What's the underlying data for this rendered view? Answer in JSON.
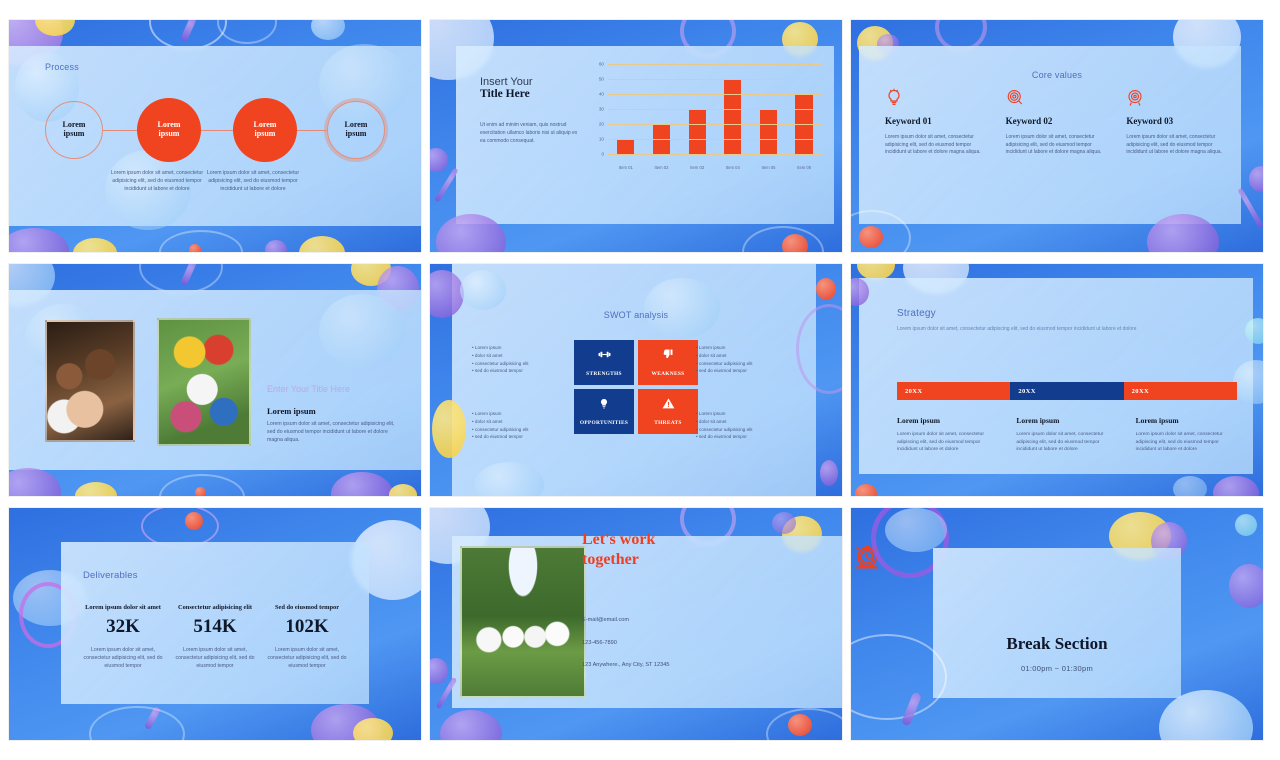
{
  "theme": {
    "accent_red": "#f0431f",
    "accent_blue": "#123d8f",
    "bg_blue": "#3f86ec",
    "panel_blue": "#bfdcfb",
    "title_color": "#4f6fbf"
  },
  "common": {
    "lorem_short": "Lorem ipsum dolor sit amet, consectetur adipisicing elit, sed do eiusmod tempor incididunt ut labore et dolore",
    "lorem_magna": "Lorem ipsum dolor sit amet, consectetur adipisicing elit, sed do eiusmod tempor incididunt ut labore et dolore magna aliqua.",
    "lorem_tempor": "Lorem ipsum dolor sit amet, consectetur adipisicing elit, sed do eiusmod tempor"
  },
  "slides": [
    {
      "id": "process",
      "title": "Process",
      "steps": [
        {
          "label": "Lorem\nipsum",
          "style": "outline"
        },
        {
          "label": "Lorem\nipsum",
          "style": "filled"
        },
        {
          "label": "Lorem\nipsum",
          "style": "filled"
        },
        {
          "label": "Lorem\nipsum",
          "style": "outline-double"
        }
      ],
      "descriptions": [
        "Lorem ipsum dolor sit amet, consectetur adipisicing elit, sed do eiusmod tempor incididunt ut labore et dolore",
        "Lorem ipsum dolor sit amet, consectetur adipisicing elit, sed do eiusmod tempor incididunt ut labore et dolore"
      ]
    },
    {
      "id": "chart",
      "title_line1": "Insert Your",
      "title_line2": "Title Here",
      "body": "Ut enim ad minim veniam, quis nostrud exercitation ullamco laboris nisi ut aliquip ex ea commodo consequat."
    },
    {
      "id": "core-values",
      "title": "Core values",
      "columns": [
        {
          "icon": "lightbulb-icon",
          "title": "Keyword 01",
          "body": "Lorem ipsum dolor sit amet, consectetur adipisicing elit, sed do eiusmod tempor incididunt ut labore et dolore magna aliqua."
        },
        {
          "icon": "target-rosette-icon",
          "title": "Keyword 02",
          "body": "Lorem ipsum dolor sit amet, consectetur adipisicing elit, sed do eiusmod tempor incididunt ut labore et dolore magna aliqua."
        },
        {
          "icon": "dartboard-icon",
          "title": "Keyword 03",
          "body": "Lorem ipsum dolor sit amet, consectetur adipisicing elit, sed do eiusmod tempor incididunt ut labore et dolore magna aliqua."
        }
      ]
    },
    {
      "id": "photos",
      "kicker": "Enter Your Title Here",
      "heading": "Lorem ipsum",
      "body": "Lorem ipsum dolor sit amet, consectetur adipisicing elit, sed do eiusmod tempor incididunt ut labore et dolore magna aliqua.",
      "photo_left_alt": "children-with-soccer-ball-photo",
      "photo_right_alt": "children-drawing-on-grass-photo"
    },
    {
      "id": "swot",
      "title": "SWOT analysis",
      "quadrants": [
        {
          "label": "STRENGTHS",
          "icon": "dumbbell-icon",
          "color": "blue"
        },
        {
          "label": "WEAKNESS",
          "icon": "thumbs-down-icon",
          "color": "red"
        },
        {
          "label": "OPPORTUNITIES",
          "icon": "lightbulb-icon",
          "color": "blue"
        },
        {
          "label": "THREATS",
          "icon": "warning-triangle-icon",
          "color": "red"
        }
      ],
      "bullets": [
        "Lorem ipsum",
        "dolor sit amet",
        "consectetur adipisicing elit",
        "sed do eiusmod tempor"
      ]
    },
    {
      "id": "strategy",
      "title": "Strategy",
      "subtitle": "Lorem ipsum dolor sit amet, consectetur adipiscing elit, sed do eiusmod tempor incididunt ut labore et dolore",
      "timeline": [
        {
          "year": "20XX",
          "color": "red"
        },
        {
          "year": "20XX",
          "color": "blue"
        },
        {
          "year": "20XX",
          "color": "red"
        }
      ],
      "columns": [
        {
          "heading": "Lorem ipsum",
          "body": "Lorem ipsum dolor sit amet, consectetur adipiscing elit, sed do eiusmod tempor incididunt ut labore et dolore"
        },
        {
          "heading": "Lorem ipsum",
          "body": "Lorem ipsum dolor sit amet, consectetur adipiscing elit, sed do eiusmod tempor incididunt ut labore et dolore"
        },
        {
          "heading": "Lorem ipsum",
          "body": "Lorem ipsum dolor sit amet, consectetur adipiscing elit, sed do eiusmod tempor incididunt ut labore et dolore"
        }
      ]
    },
    {
      "id": "deliverables",
      "title": "Deliverables",
      "metrics": [
        {
          "caption": "Lorem ipsum dolor sit amet",
          "value": "32K",
          "body": "Lorem ipsum dolor sit amet, consectetur adipisicing elit, sed do eiusmod tempor"
        },
        {
          "caption": "Consectetur adipisicing elit",
          "value": "514K",
          "body": "Lorem ipsum dolor sit amet, consectetur adipisicing elit, sed do eiusmod tempor"
        },
        {
          "caption": "Sed do eiusmod tempor",
          "value": "102K",
          "body": "Lorem ipsum dolor sit amet, consectetur adipisicing elit, sed do eiusmod tempor"
        }
      ]
    },
    {
      "id": "contact",
      "heading_line1": "Let's work",
      "heading_line2": "together",
      "email": "E-mail@email.com",
      "phone": "123-456-7890",
      "address": "123 Anywhere., Any City, ST 12345",
      "photo_alt": "four-children-running-photo"
    },
    {
      "id": "break",
      "icon": "alarm-clock-icon",
      "heading": "Break Section",
      "time": "01:00pm ~ 01:30pm"
    }
  ],
  "chart_data": {
    "type": "bar",
    "title": "Insert Your Title Here",
    "categories": [
      "Item 01",
      "Item 02",
      "Item 03",
      "Item 04",
      "Item 05",
      "Item 06"
    ],
    "values": [
      10,
      20,
      30,
      50,
      30,
      40
    ],
    "yticks": [
      0,
      10,
      20,
      30,
      40,
      50,
      60
    ],
    "ylim": [
      0,
      60
    ],
    "xlabel": "",
    "ylabel": "",
    "grid": true,
    "legend": false,
    "bar_color": "#f0431f",
    "gridline_color": "#e8c98a"
  }
}
